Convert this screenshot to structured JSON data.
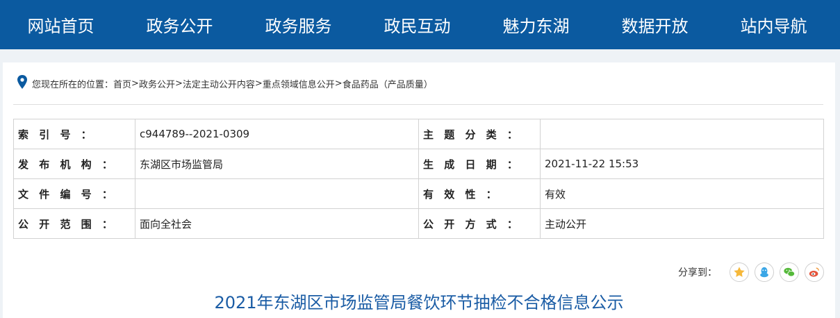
{
  "nav": {
    "items": [
      "网站首页",
      "政务公开",
      "政务服务",
      "政民互动",
      "魅力东湖",
      "数据开放",
      "站内导航"
    ]
  },
  "breadcrumb": {
    "prefix": "您现在所在的位置：",
    "items": [
      "首页",
      "政务公开",
      "法定主动公开内容",
      "重点领域信息公开",
      "食品药品（产品质量）"
    ],
    "separator": ">"
  },
  "meta": {
    "rows": [
      {
        "k1": "索 引 号 ：",
        "v1": "c944789--2021-0309",
        "k2": "主 题 分 类 ：",
        "v2": ""
      },
      {
        "k1": "发 布 机 构 ：",
        "v1": "东湖区市场监管局",
        "k2": "生 成 日 期 ：",
        "v2": "2021-11-22 15:53"
      },
      {
        "k1": "文 件 编 号 ：",
        "v1": "",
        "k2": "有 效 性 ：",
        "v2": "有效"
      },
      {
        "k1": "公 开 范 围 ：",
        "v1": "面向全社会",
        "k2": "公 开 方 式 ：",
        "v2": "主动公开"
      }
    ]
  },
  "share": {
    "label": "分享到：",
    "icons": [
      "qzone-star-icon",
      "qq-penguin-icon",
      "wechat-icon",
      "weibo-icon"
    ]
  },
  "article": {
    "title": "2021年东湖区市场监管局餐饮环节抽检不合格信息公示"
  },
  "colors": {
    "nav_bg": "#0b5aa0",
    "title": "#1a5ca5",
    "page_bg": "#eef2f6"
  }
}
